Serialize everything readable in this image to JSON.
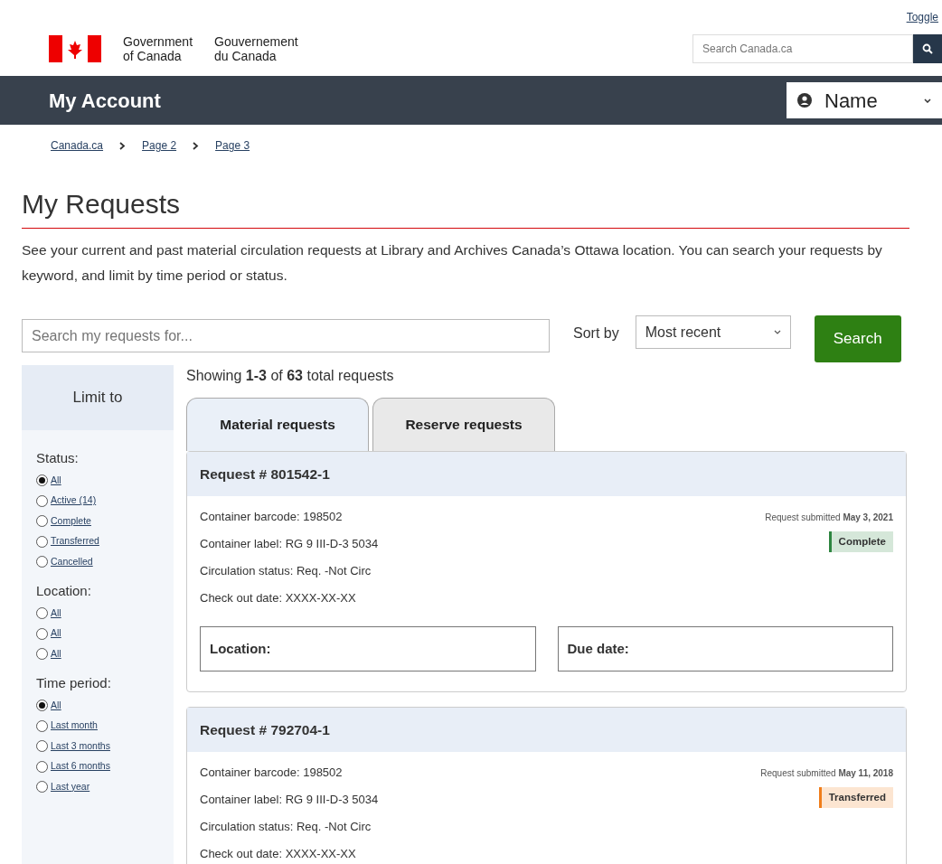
{
  "top_link": "Toggle",
  "brand": {
    "en": [
      "Government",
      "of Canada"
    ],
    "fr": [
      "Gouvernement",
      "du Canada"
    ]
  },
  "site_search": {
    "placeholder": "Search Canada.ca"
  },
  "account_bar": {
    "title": "My Account",
    "user_menu": "Name"
  },
  "breadcrumb": [
    "Canada.ca",
    "Page 2",
    "Page 3"
  ],
  "heading": "My Requests",
  "intro": "See your current and past material circulation requests at Library and Archives Canada’s Ottawa location. You can search your requests by keyword, and limit by time period or status.",
  "search": {
    "placeholder": "Search my requests for...",
    "sort_label": "Sort by",
    "sort_value": "Most recent",
    "button": "Search"
  },
  "sidebar": {
    "title": "Limit to",
    "groups": [
      {
        "label": "Status:",
        "options": [
          {
            "label": "All",
            "selected": true
          },
          {
            "label": "Active (14)",
            "selected": false
          },
          {
            "label": "Complete",
            "selected": false
          },
          {
            "label": "Transferred",
            "selected": false
          },
          {
            "label": "Cancelled",
            "selected": false
          }
        ]
      },
      {
        "label": "Location:",
        "options": [
          {
            "label": "All",
            "selected": false
          },
          {
            "label": "All",
            "selected": false
          },
          {
            "label": "All",
            "selected": false
          }
        ]
      },
      {
        "label": "Time period:",
        "options": [
          {
            "label": "All",
            "selected": true
          },
          {
            "label": "Last month",
            "selected": false
          },
          {
            "label": "Last 3 months",
            "selected": false
          },
          {
            "label": "Last 6 months",
            "selected": false
          },
          {
            "label": "Last year",
            "selected": false
          }
        ]
      }
    ]
  },
  "results_summary": "Showing **1-3** of **63** total requests",
  "tabs": [
    {
      "label": "Material requests",
      "selected": true
    },
    {
      "label": "Reserve requests",
      "selected": false
    }
  ],
  "requests": [
    {
      "title": "Request # 801542-1",
      "fields": [
        "Container barcode: 198502",
        "Container label: RG 9 III-D-3 5034",
        "Circulation status: Req. -Not Circ",
        "Check out date: XXXX-XX-XX"
      ],
      "submitted": "Request submitted **May 3, 2021**",
      "status": "Complete",
      "color": "#2e8540",
      "boxes": [
        "Location:",
        "Due date:"
      ]
    },
    {
      "title": "Request # 792704-1",
      "fields": [
        "Container barcode: 198502",
        "Container label: RG 9 III-D-3 5034",
        "Circulation status: Req. -Not Circ",
        "Check out date: XXXX-XX-XX"
      ],
      "submitted": "Request submitted **May 11, 2018**",
      "status": "Transferred",
      "color": "#f07d1a"
    }
  ]
}
